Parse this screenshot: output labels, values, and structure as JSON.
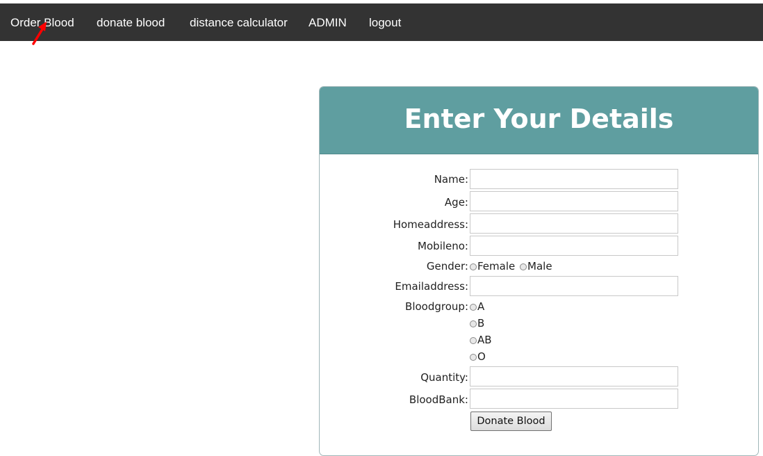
{
  "nav": {
    "items": [
      {
        "label": "Order Blood"
      },
      {
        "label": "donate blood"
      },
      {
        "label": "distance calculator"
      },
      {
        "label": "ADMIN"
      },
      {
        "label": "logout"
      }
    ]
  },
  "form": {
    "title": "Enter Your Details",
    "labels": {
      "name": "Name:",
      "age": "Age:",
      "homeaddress": "Homeaddress:",
      "mobileno": "Mobileno:",
      "gender": "Gender:",
      "emailaddress": "Emailaddress:",
      "bloodgroup": "Bloodgroup:",
      "quantity": "Quantity:",
      "bloodbank": "BloodBank:"
    },
    "values": {
      "name": "",
      "age": "",
      "homeaddress": "",
      "mobileno": "",
      "emailaddress": "",
      "quantity": "",
      "bloodbank": ""
    },
    "gender_options": [
      "Female",
      "Male"
    ],
    "bloodgroup_options": [
      "A",
      "B",
      "AB",
      "O"
    ],
    "submit_label": "Donate Blood"
  },
  "colors": {
    "navbar": "#333333",
    "header": "#5f9ea0",
    "cursor": "#ff0000"
  }
}
